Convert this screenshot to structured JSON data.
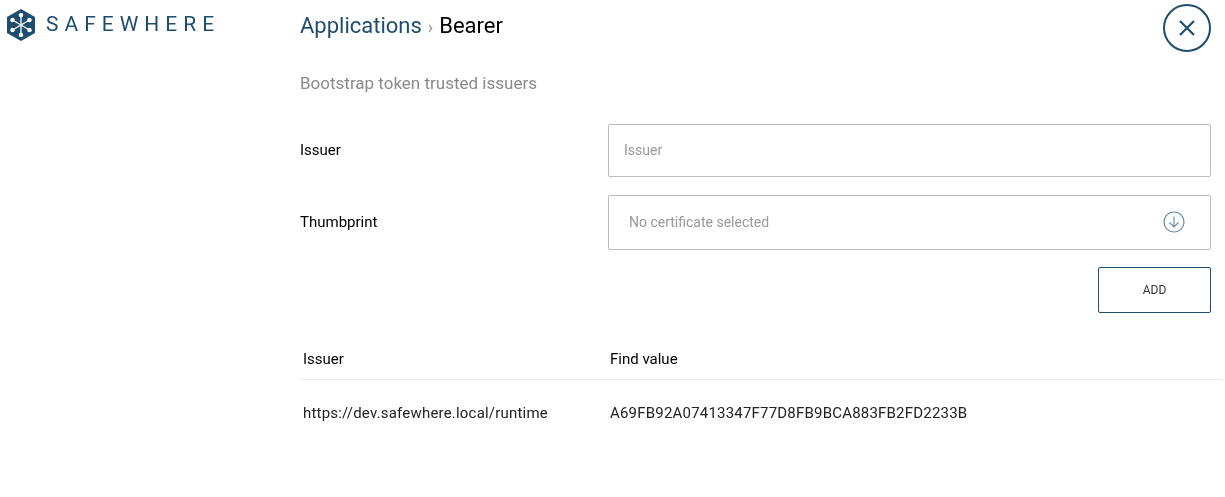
{
  "logo": {
    "text": "SAFEWHERE"
  },
  "breadcrumb": {
    "parent": "Applications",
    "separator": "›",
    "current": "Bearer"
  },
  "section_title": "Bootstrap token trusted issuers",
  "form": {
    "fields": [
      {
        "kind": "text",
        "label": "Issuer",
        "placeholder": "Issuer"
      },
      {
        "kind": "select",
        "label": "Thumbprint",
        "placeholder": "No certificate selected"
      }
    ],
    "button": "ADD"
  },
  "table": {
    "columns": [
      "Issuer",
      "Find value"
    ],
    "rows": [
      [
        "https://dev.safewhere.local/runtime",
        "A69FB92A07413347F77D8FB9BCA883FB2FD2233B"
      ]
    ]
  }
}
